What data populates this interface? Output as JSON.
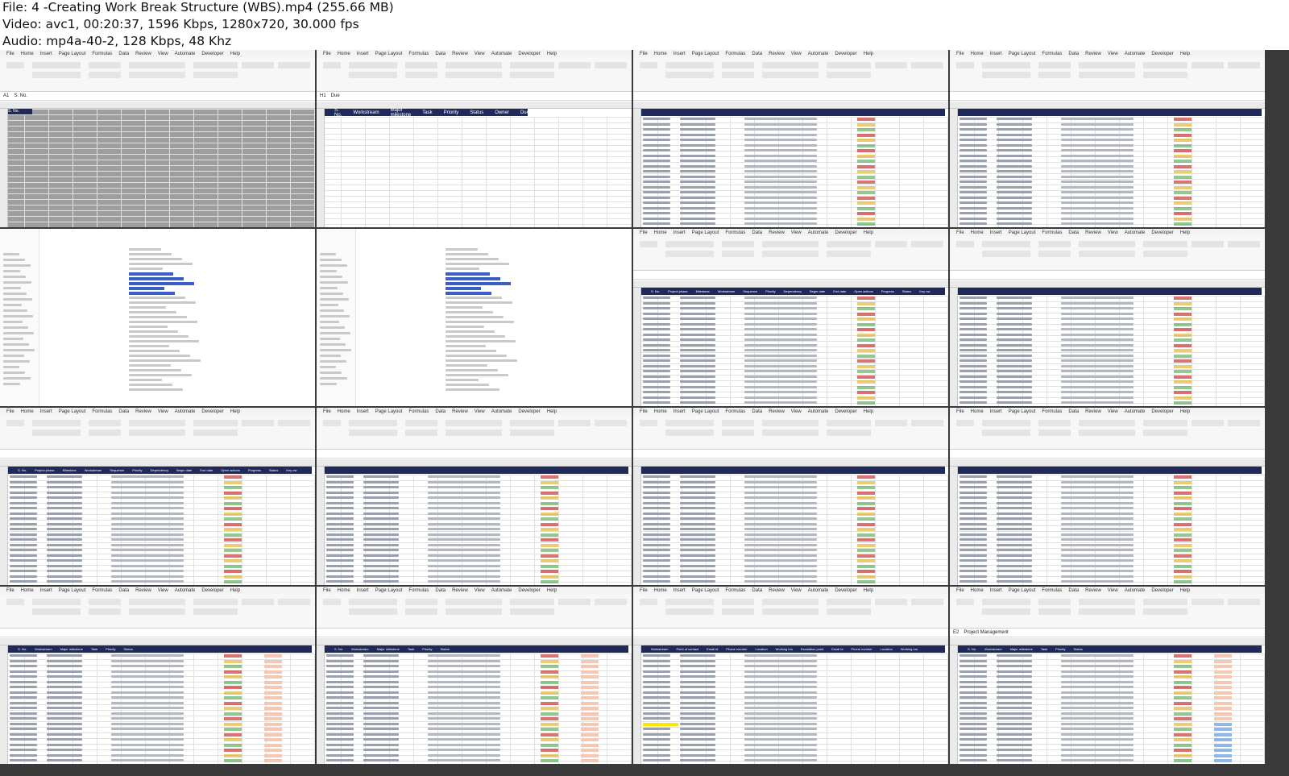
{
  "header": {
    "file_line": "File: 4 -Creating Work Break Structure (WBS).mp4 (255.66 MB)",
    "video_line": "Video: avc1, 00:20:37, 1596 Kbps, 1280x720, 30.000 fps",
    "audio_line": "Audio: mp4a-40-2, 128 Kbps, 48 Khz"
  },
  "thumbnails": {
    "t1": {
      "menu": [
        "File",
        "Home",
        "Insert",
        "Page Layout",
        "Formulas",
        "Data",
        "Review",
        "View",
        "Automate",
        "Developer",
        "Help"
      ],
      "font_name": "Aptos Narrow",
      "font_size": "11",
      "number_format": "General",
      "wrap_text": "Wrap Text",
      "merge_center": "Merge & Center",
      "cell_ref": "A1",
      "formula": "S. No.",
      "header_cell": "S. No.",
      "group_labels": [
        "Clipboard",
        "Font",
        "Alignment",
        "Number"
      ]
    },
    "t2": {
      "cell_ref": "H1",
      "formula": "Due",
      "columns": [
        "S. No.",
        "Workstream",
        "Major milestone",
        "Task",
        "Priority",
        "Status",
        "Owner",
        "Due"
      ]
    },
    "t5": {
      "columns": [
        "S. No.",
        "Project phase",
        "Milestone",
        "Workstream",
        "Sequence",
        "Priority",
        "Dependency",
        "Begin date",
        "End date",
        "Open actions",
        "Progress",
        "Status",
        "Key ow"
      ],
      "phases": [
        "Initiating",
        "Initiating",
        "Planning",
        "Planning",
        "Planning",
        "Execution",
        "Execution",
        "Execution",
        "Execution",
        "Execution",
        "Execution",
        "Execution",
        "Execution",
        "Execution",
        "Execution",
        "Closure"
      ],
      "milestones": [
        "Project overview",
        "Alignment of resources",
        "Kick-off",
        "Brainstorming",
        "Project Plan - Signed off",
        "Governance plan",
        "Empanelment of vendor",
        "Layout and design - Signed off",
        "Permits and regulation",
        "Begin revamping site",
        "Lights and fixtures",
        "IT and Network",
        "End to end testing - Signed off",
        "Inauguration",
        "Commissioning of new space",
        "Closure"
      ],
      "workstreams": [
        "Project Management",
        "HR",
        "Project Management",
        "Project Management",
        "Project Management",
        "Corporate communications",
        "Procurement",
        "Facility",
        "Health and safety",
        "Facility",
        "Facility",
        "Local IT",
        "Local IT",
        "Corporate communications",
        "Facility",
        "Project Management"
      ]
    },
    "t16": {
      "cell_ref": "E2",
      "formula": "Project Management",
      "columns": [
        "S. No.",
        "Workstream",
        "Major milestone",
        "Task",
        "Priority",
        "Status"
      ],
      "status_values": [
        "Open",
        "Closed"
      ]
    },
    "t15": {
      "columns": [
        "Workstream",
        "Point of contact",
        "Email id",
        "Phone number",
        "Location",
        "Working hrs",
        "Escalation point",
        "Email id",
        "Phone number",
        "Location",
        "Working hrs"
      ],
      "workstreams": [
        "Local IT",
        "HR",
        "Finance",
        "Corporate communications",
        "Facility",
        "House Keeping",
        "Vendor Management",
        "Procurement",
        "Information Security",
        "Risk management",
        "BCP team",
        "Health and safety",
        "Sustainability",
        "Project Management"
      ],
      "contacts": [
        "John",
        "Sweta",
        "Mark"
      ]
    }
  }
}
